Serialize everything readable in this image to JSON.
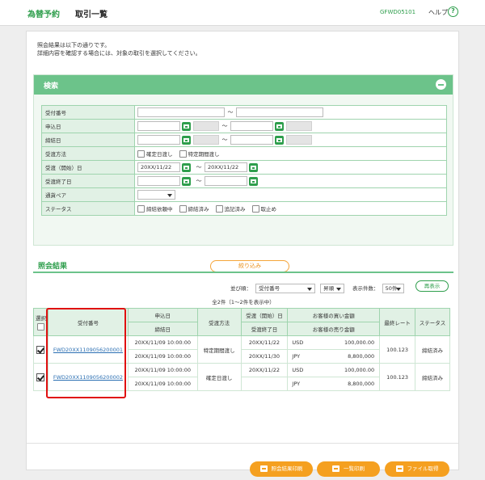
{
  "header": {
    "brand": "為替予約",
    "page_title": "取引一覧",
    "screen_id": "GFWD05101",
    "help_label": "ヘルプ",
    "help_icon_glyph": "?"
  },
  "intro": {
    "line1": "照会結果は以下の通りです。",
    "line2": "詳細内容を確認する場合には、対象の取引を選択してください。"
  },
  "search": {
    "title": "検索",
    "labels": {
      "receipt_no": "受付番号",
      "apply_date": "申込日",
      "contract_date": "締結日",
      "delivery_method": "受渡方法",
      "delivery_start": "受渡（開始）日",
      "delivery_end": "受渡終了日",
      "currency_pair": "通貨ペア",
      "status": "ステータス"
    },
    "tilde": "～",
    "delivery_options": [
      "確定日渡し",
      "特定期間渡し"
    ],
    "delivery_start_from": "20XX/11/22",
    "delivery_start_to": "20XX/11/22",
    "status_options": [
      "締結依頼中",
      "締結済み",
      "追記済み",
      "取止め"
    ],
    "narrow_button": "絞り込み"
  },
  "results": {
    "title": "照会結果",
    "sort_label": "並び順：",
    "sort_key": "受付番号",
    "sort_order": "昇順",
    "per_page_label": "表示件数：",
    "per_page_value": "50件",
    "redisplay_button": "再表示",
    "count_text": "全2件（1～2件を表示中）",
    "headers": {
      "select": "選択",
      "receipt_no": "受付番号",
      "apply_date": "申込日",
      "contract_date": "締結日",
      "delivery_method": "受渡方法",
      "delivery_start": "受渡（開始）日",
      "delivery_end": "受渡終了日",
      "buy_amount": "お客様の買い金額",
      "sell_amount": "お客様の売り金額",
      "final_rate": "最終レート",
      "status": "ステータス"
    },
    "rows": [
      {
        "receipt_no": "FWD20XX1109056200001",
        "apply_date": "20XX/11/09 10:00:00",
        "contract_date": "20XX/11/09 10:00:00",
        "delivery_method": "特定期間渡し",
        "delivery_start": "20XX/11/22",
        "delivery_end": "20XX/11/30",
        "buy_currency": "USD",
        "buy_amount": "100,000.00",
        "sell_currency": "JPY",
        "sell_amount": "8,800,000",
        "final_rate": "100.123",
        "status": "締結済み"
      },
      {
        "receipt_no": "FWD20XX1109056200002",
        "apply_date": "20XX/11/09 10:00:00",
        "contract_date": "20XX/11/09 10:00:00",
        "delivery_method": "確定日渡し",
        "delivery_start": "20XX/11/22",
        "delivery_end": "",
        "buy_currency": "USD",
        "buy_amount": "100,000.00",
        "sell_currency": "JPY",
        "sell_amount": "8,800,000",
        "final_rate": "100.123",
        "status": "締結済み"
      }
    ]
  },
  "footer": {
    "print_results": "照会結果印刷",
    "print_list": "一覧印刷",
    "get_file": "ファイル取得"
  },
  "colors": {
    "accent_green": "#2e9e4c",
    "panel_header_green": "#6cc38a",
    "button_orange": "#f5a020",
    "highlight_red": "#e01010"
  }
}
